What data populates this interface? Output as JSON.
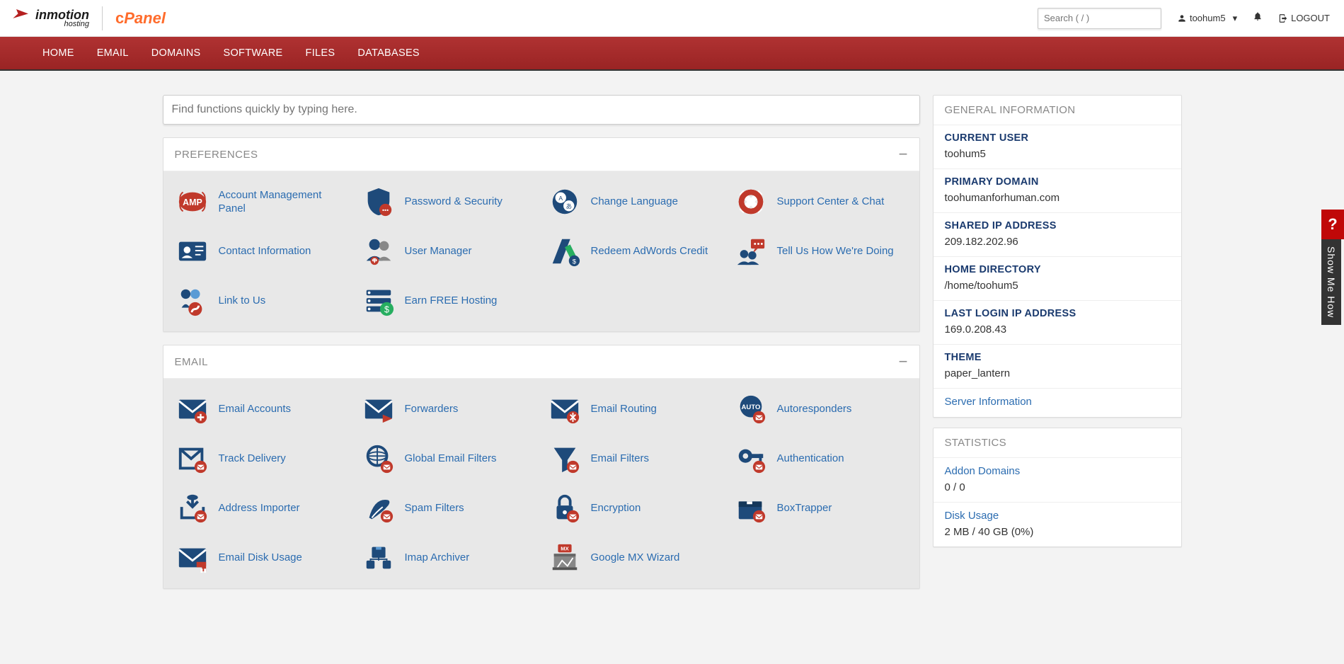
{
  "header": {
    "brand1": "inmotion",
    "brand1_sub": "hosting",
    "brand2": "cPanel",
    "search_placeholder": "Search ( / )",
    "username": "toohum5",
    "logout": "LOGOUT"
  },
  "nav": {
    "items": [
      "HOME",
      "EMAIL",
      "DOMAINS",
      "SOFTWARE",
      "FILES",
      "DATABASES"
    ]
  },
  "func_search_placeholder": "Find functions quickly by typing here.",
  "sections": {
    "preferences": {
      "title": "PREFERENCES",
      "items": [
        {
          "label": "Account Management Panel",
          "icon": "amp"
        },
        {
          "label": "Password & Security",
          "icon": "shield-lock"
        },
        {
          "label": "Change Language",
          "icon": "language"
        },
        {
          "label": "Support Center & Chat",
          "icon": "support"
        },
        {
          "label": "Contact Information",
          "icon": "contact"
        },
        {
          "label": "User Manager",
          "icon": "users"
        },
        {
          "label": "Redeem AdWords Credit",
          "icon": "adwords"
        },
        {
          "label": "Tell Us How We're Doing",
          "icon": "feedback"
        },
        {
          "label": "Link to Us",
          "icon": "link"
        },
        {
          "label": "Earn FREE Hosting",
          "icon": "earn"
        }
      ]
    },
    "email": {
      "title": "EMAIL",
      "items": [
        {
          "label": "Email Accounts",
          "icon": "email-add"
        },
        {
          "label": "Forwarders",
          "icon": "email-fwd"
        },
        {
          "label": "Email Routing",
          "icon": "email-route"
        },
        {
          "label": "Autoresponders",
          "icon": "auto"
        },
        {
          "label": "Track Delivery",
          "icon": "track"
        },
        {
          "label": "Global Email Filters",
          "icon": "global-filter"
        },
        {
          "label": "Email Filters",
          "icon": "filter"
        },
        {
          "label": "Authentication",
          "icon": "auth"
        },
        {
          "label": "Address Importer",
          "icon": "import"
        },
        {
          "label": "Spam Filters",
          "icon": "spam"
        },
        {
          "label": "Encryption",
          "icon": "encrypt"
        },
        {
          "label": "BoxTrapper",
          "icon": "boxtrap"
        },
        {
          "label": "Email Disk Usage",
          "icon": "disk-usage"
        },
        {
          "label": "Imap Archiver",
          "icon": "archive"
        },
        {
          "label": "Google MX Wizard",
          "icon": "mx"
        }
      ]
    }
  },
  "general_info": {
    "title": "GENERAL INFORMATION",
    "rows": [
      {
        "k": "CURRENT USER",
        "v": "toohum5"
      },
      {
        "k": "PRIMARY DOMAIN",
        "v": "toohumanforhuman.com"
      },
      {
        "k": "SHARED IP ADDRESS",
        "v": "209.182.202.96"
      },
      {
        "k": "HOME DIRECTORY",
        "v": "/home/toohum5"
      },
      {
        "k": "LAST LOGIN IP ADDRESS",
        "v": "169.0.208.43"
      },
      {
        "k": "THEME",
        "v": "paper_lantern"
      }
    ],
    "server_info_link": "Server Information"
  },
  "statistics": {
    "title": "STATISTICS",
    "rows": [
      {
        "label": "Addon Domains",
        "value": "0 / 0"
      },
      {
        "label": "Disk Usage",
        "value": "2 MB / 40 GB   (0%)"
      }
    ]
  },
  "help_tab": {
    "q": "?",
    "text": "Show Me How"
  }
}
